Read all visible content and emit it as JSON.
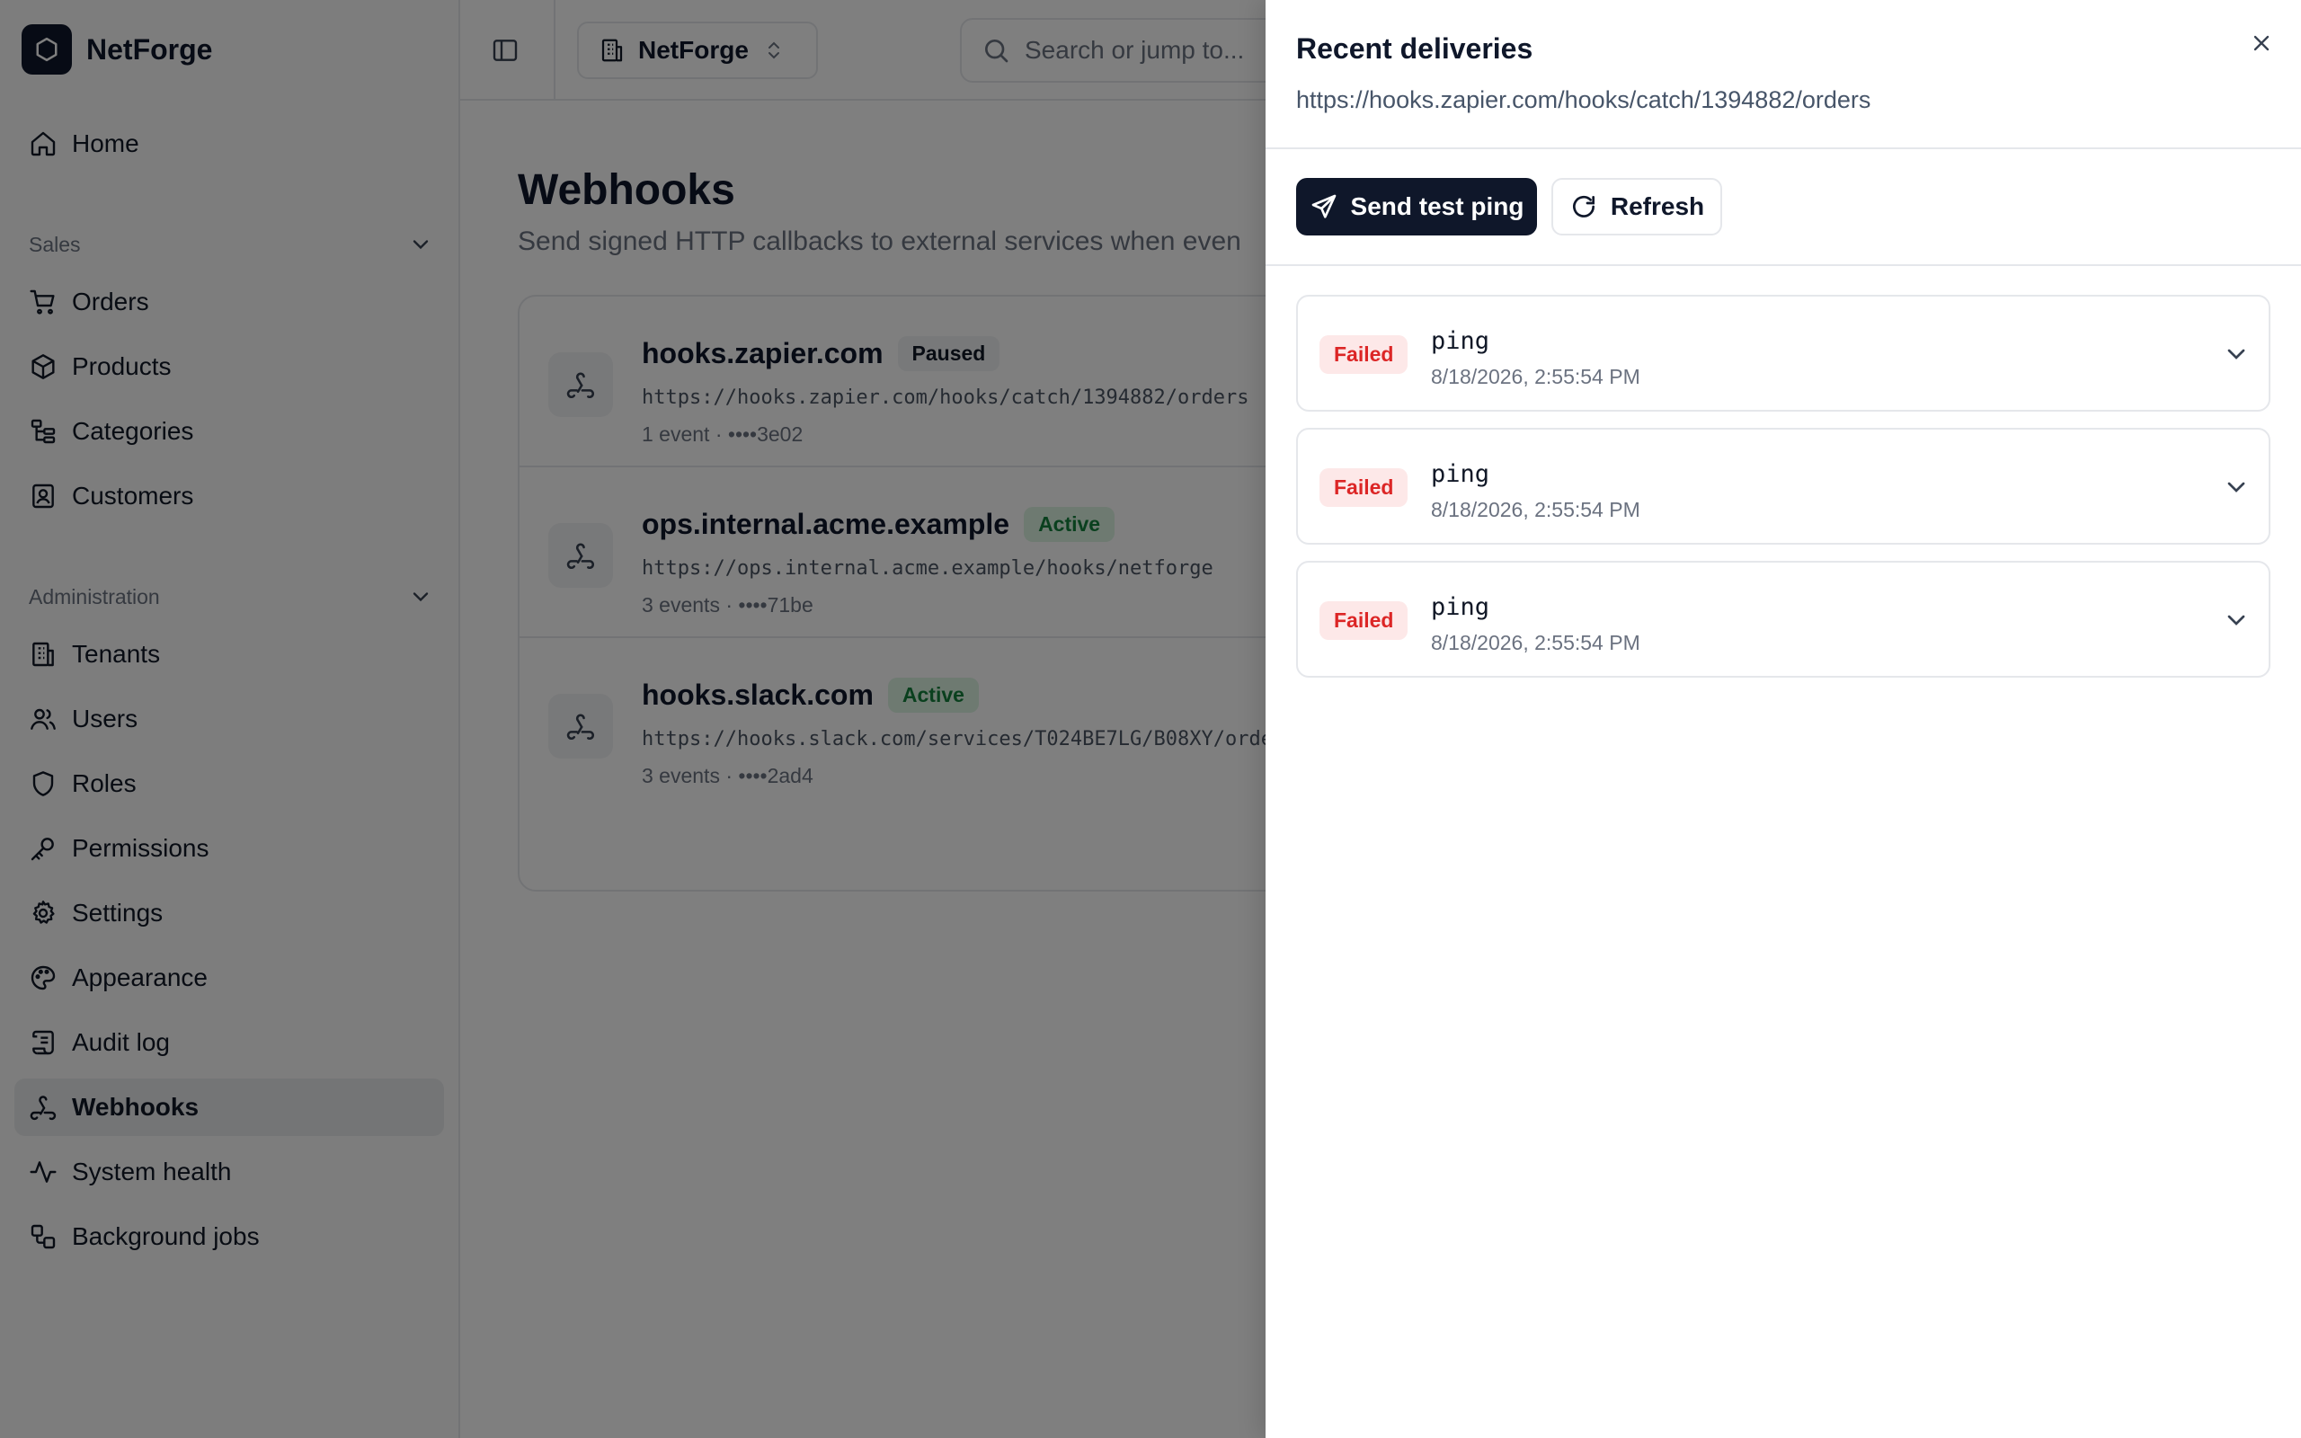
{
  "brand": {
    "name": "NetForge"
  },
  "sidebar": {
    "home": "Home",
    "sections": [
      {
        "label": "Sales",
        "items": [
          "Orders",
          "Products",
          "Categories",
          "Customers"
        ]
      },
      {
        "label": "Administration",
        "items": [
          "Tenants",
          "Users",
          "Roles",
          "Permissions",
          "Settings",
          "Appearance",
          "Audit log",
          "Webhooks",
          "System health",
          "Background jobs"
        ]
      }
    ],
    "active_item": "Webhooks"
  },
  "topbar": {
    "tenant": "NetForge",
    "search_placeholder": "Search or jump to..."
  },
  "page": {
    "title": "Webhooks",
    "subtitle": "Send signed HTTP callbacks to external services when even"
  },
  "webhooks": [
    {
      "host": "hooks.zapier.com",
      "status": "Paused",
      "url": "https://hooks.zapier.com/hooks/catch/1394882/orders",
      "meta": "1 event · ••••3e02"
    },
    {
      "host": "ops.internal.acme.example",
      "status": "Active",
      "url": "https://ops.internal.acme.example/hooks/netforge",
      "meta": "3 events · ••••71be"
    },
    {
      "host": "hooks.slack.com",
      "status": "Active",
      "url": "https://hooks.slack.com/services/T024BE7LG/B08XY/orde",
      "meta": "3 events · ••••2ad4"
    }
  ],
  "drawer": {
    "title": "Recent deliveries",
    "url": "https://hooks.zapier.com/hooks/catch/1394882/orders",
    "send_label": "Send test ping",
    "refresh_label": "Refresh",
    "deliveries": [
      {
        "status": "Failed",
        "event": "ping",
        "time": "8/18/2026, 2:55:54 PM"
      },
      {
        "status": "Failed",
        "event": "ping",
        "time": "8/18/2026, 2:55:54 PM"
      },
      {
        "status": "Failed",
        "event": "ping",
        "time": "8/18/2026, 2:55:54 PM"
      }
    ]
  },
  "colors": {
    "primary": "#0f172a",
    "failed": "#dc2626",
    "active": "#15803d"
  }
}
